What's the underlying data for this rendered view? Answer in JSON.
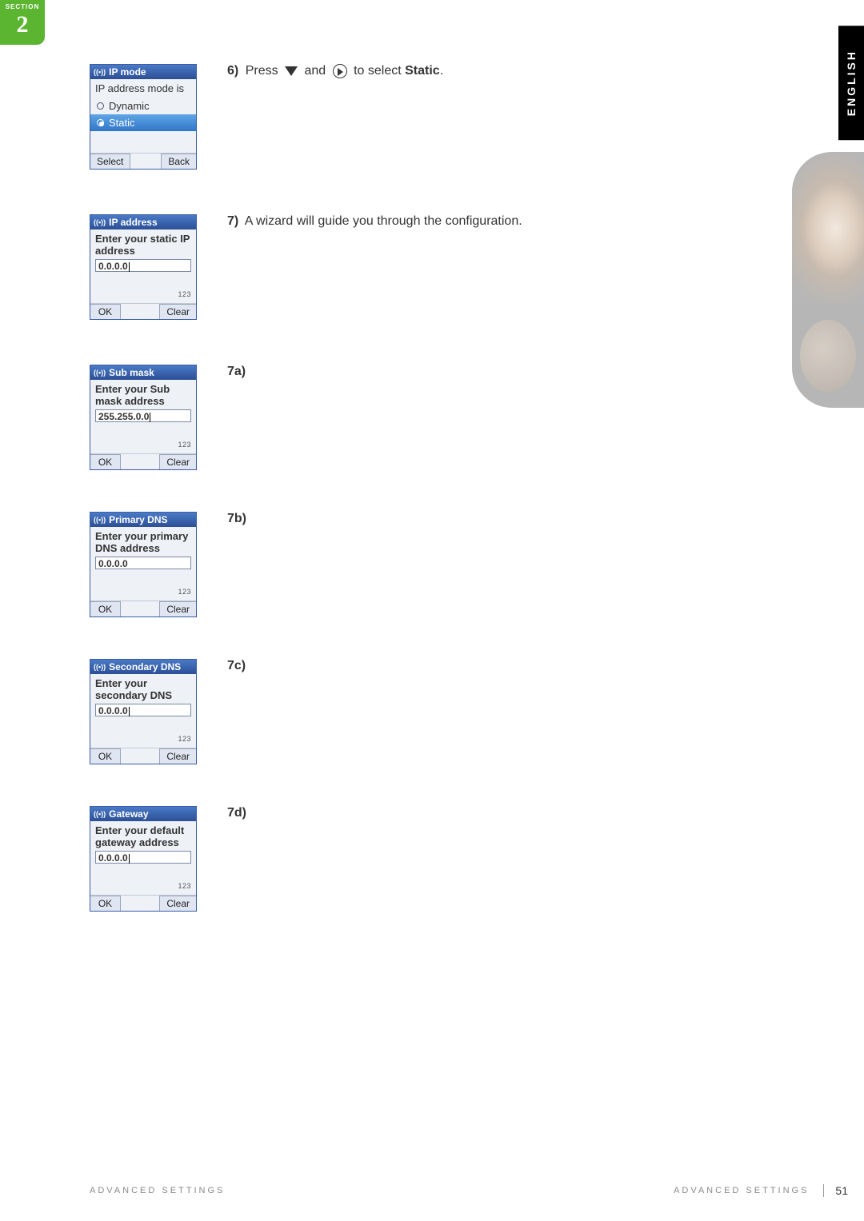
{
  "section": {
    "label": "SECTION",
    "number": "2"
  },
  "language_tab": "ENGLISH",
  "steps": [
    {
      "id": "6",
      "marker": "6)",
      "text_prefix": "Press ",
      "text_mid": " and ",
      "text_suffix": " to select ",
      "text_bold": "Static",
      "text_end": ".",
      "phone": {
        "variant": "ipmode",
        "title": "IP mode",
        "hint": "IP address mode is",
        "options": [
          {
            "label": "Dynamic",
            "selected": false,
            "highlight": false
          },
          {
            "label": "Static",
            "selected": true,
            "highlight": true
          }
        ],
        "soft_left": "Select",
        "soft_right": "Back"
      }
    },
    {
      "id": "7",
      "marker": "7)",
      "text_plain": "A wizard will guide you through the configuration.",
      "phone": {
        "variant": "input",
        "title": "IP address",
        "hint": "Enter your static IP address",
        "value": "0.0.0.0",
        "mode": "123",
        "soft_left": "OK",
        "soft_right": "Clear"
      }
    },
    {
      "id": "7a",
      "marker": "7a)",
      "phone": {
        "variant": "input",
        "title": "Sub mask",
        "hint": "Enter your Sub mask address",
        "value": "255.255.0.0",
        "mode": "123",
        "soft_left": "OK",
        "soft_right": "Clear"
      }
    },
    {
      "id": "7b",
      "marker": "7b)",
      "phone": {
        "variant": "input",
        "title": "Primary DNS",
        "hint": "Enter your primary DNS address",
        "value": "0.0.0.0",
        "mode": "123",
        "soft_left": "OK",
        "soft_right": "Clear"
      }
    },
    {
      "id": "7c",
      "marker": "7c)",
      "phone": {
        "variant": "input",
        "title": "Secondary DNS",
        "hint": "Enter your secondary DNS",
        "value": "0.0.0.0",
        "mode": "123",
        "soft_left": "OK",
        "soft_right": "Clear"
      }
    },
    {
      "id": "7d",
      "marker": "7d)",
      "phone": {
        "variant": "input",
        "title": "Gateway",
        "hint": "Enter your default gateway address",
        "value": "0.0.0.0",
        "mode": "123",
        "soft_left": "OK",
        "soft_right": "Clear"
      }
    }
  ],
  "footer": {
    "left": "ADVANCED SETTINGS",
    "right": "ADVANCED SETTINGS",
    "page": "51"
  }
}
